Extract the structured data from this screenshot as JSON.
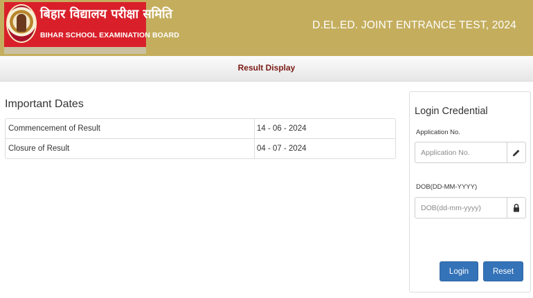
{
  "header": {
    "logo_hindi": "बिहार विद्यालय परीक्षा समिति",
    "logo_english": "BIHAR SCHOOL EXAMINATION BOARD",
    "exam_title": "D.EL.ED. JOINT ENTRANCE TEST, 2024"
  },
  "nav": {
    "title": "Result Display"
  },
  "important_dates": {
    "heading": "Important Dates",
    "rows": [
      {
        "label": "Commencement of Result",
        "value": "14 - 06 - 2024"
      },
      {
        "label": "Closure of Result",
        "value": "04 - 07 - 2024"
      }
    ]
  },
  "login": {
    "title": "Login Credential",
    "application_label": "Application No.",
    "application_placeholder": "Application No.",
    "dob_label": "DOB(DD-MM-YYYY)",
    "dob_placeholder": "DOB(dd-mm-yyyy)",
    "login_button": "Login",
    "reset_button": "Reset"
  },
  "icons": {
    "application_addon": "pencil-icon",
    "dob_addon": "lock-icon"
  },
  "colors": {
    "header_bg": "#c4ae5e",
    "logo_red": "#d9202a",
    "nav_text": "#7a1a14",
    "button_blue": "#3473b8"
  }
}
